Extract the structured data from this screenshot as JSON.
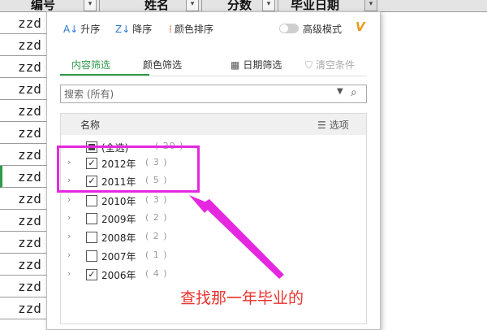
{
  "sheet": {
    "headers": [
      "编号",
      "姓名",
      "分数",
      "毕业日期"
    ],
    "rows": [
      "zzd",
      "zzd",
      "zzd",
      "zzd",
      "zzd",
      "zzd",
      "zzd",
      "zzd",
      "zzd",
      "zzd",
      "zzd",
      "zzd",
      "zzd",
      "zzd"
    ]
  },
  "toolbar": {
    "sort_asc": "升序",
    "sort_desc": "降序",
    "color_sort": "颜色排序",
    "advanced_mode": "高级模式",
    "logo": "V"
  },
  "tabs": {
    "content_filter": "内容筛选",
    "color_filter": "颜色筛选",
    "date_filter": "日期筛选",
    "clear": "清空条件"
  },
  "search": {
    "placeholder": "搜索 (所有)"
  },
  "list": {
    "header_name": "名称",
    "header_options": "选项",
    "all": {
      "label": "(全选)",
      "count": "( 20 )"
    },
    "items": [
      {
        "label": "2012年",
        "count": "( 3 )",
        "checked": true
      },
      {
        "label": "2011年",
        "count": "( 5 )",
        "checked": true
      },
      {
        "label": "2010年",
        "count": "( 3 )",
        "checked": false
      },
      {
        "label": "2009年",
        "count": "( 2 )",
        "checked": false
      },
      {
        "label": "2008年",
        "count": "( 2 )",
        "checked": false
      },
      {
        "label": "2007年",
        "count": "( 1 )",
        "checked": false
      },
      {
        "label": "2006年",
        "count": "( 4 )",
        "checked": true
      }
    ]
  },
  "annotation": {
    "text": "查找那一年毕业的",
    "color": "#e528e0",
    "text_color": "#e6322d"
  },
  "colors": {
    "accent": "#2e9a4a"
  }
}
